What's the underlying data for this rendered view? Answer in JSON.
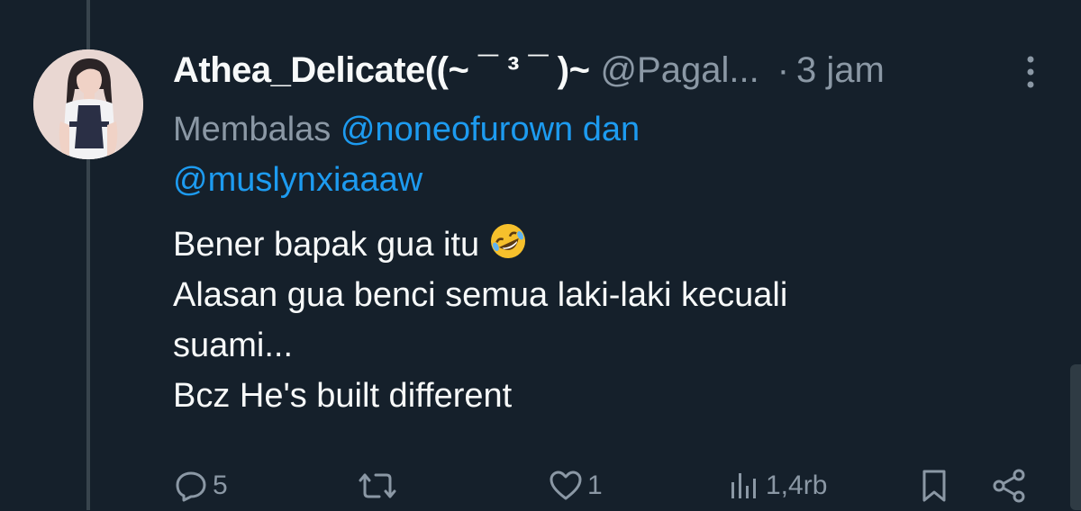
{
  "tweet": {
    "display_name": "Athea_Delicate((~ ¯ ³ ¯ )~",
    "handle": "@Pagal...",
    "separator": "·",
    "time": "3 jam",
    "more_icon": "more-vertical-icon",
    "reply_prefix": "Membalas",
    "reply_mention_1": "@noneofurown",
    "reply_joiner": "dan",
    "reply_mention_2": "@muslynxiaaaw",
    "body_lines": [
      "Bener bapak gua itu",
      "Alasan gua benci semua laki-laki kecuali",
      "suami...",
      "Bcz He's built different"
    ],
    "emoji": "rolling-on-floor-laughing-emoji"
  },
  "actions": {
    "reply": {
      "icon": "reply-icon",
      "count": "5"
    },
    "retweet": {
      "icon": "retweet-icon",
      "count": ""
    },
    "like": {
      "icon": "heart-icon",
      "count": "1"
    },
    "views": {
      "icon": "views-icon",
      "count": "1,4rb"
    },
    "bookmark": {
      "icon": "bookmark-icon"
    },
    "share": {
      "icon": "share-icon"
    }
  },
  "colors": {
    "background": "#15202b",
    "text": "#f7f9f9",
    "muted": "#8b98a5",
    "accent": "#1d9bf0"
  }
}
